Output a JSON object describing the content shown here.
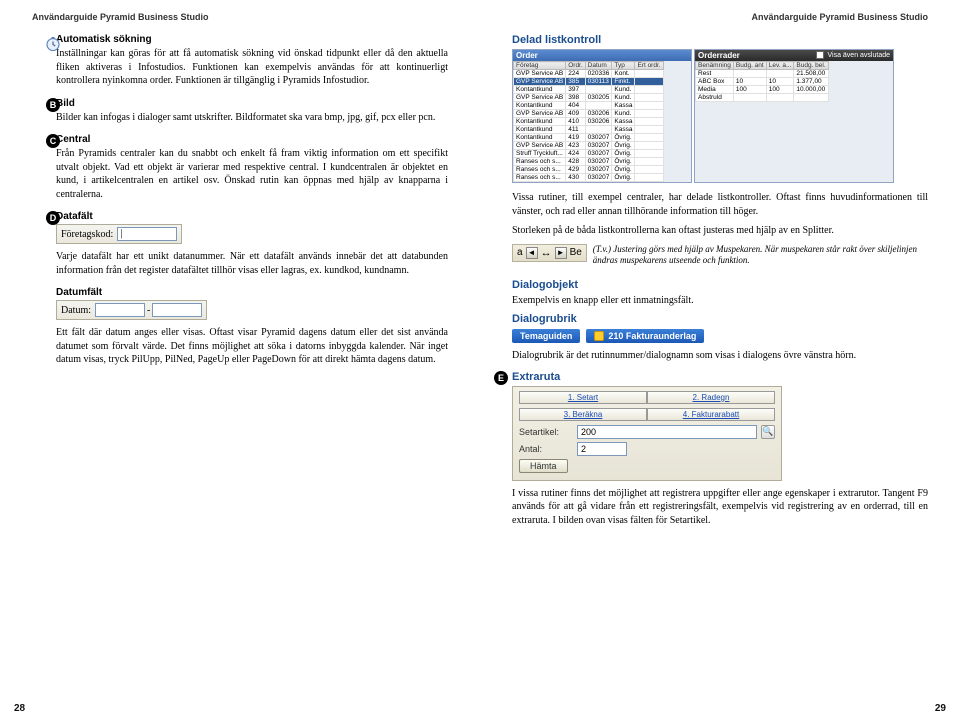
{
  "header": "Användarguide Pyramid Business Studio",
  "left": {
    "auto": {
      "title": "Automatisk sökning",
      "text": "Inställningar kan göras för att få automatisk sökning vid önskad tidpunkt eller då den aktuella fliken aktiveras i Infostudios. Funktionen kan exempelvis användas för att kontinuerligt kontrollera nyinkomna order. Funktionen är tillgänglig i Pyramids Infostudior."
    },
    "bild": {
      "letter": "B",
      "title": "Bild",
      "text": "Bilder kan infogas i dialoger samt utskrifter. Bildformatet ska vara bmp, jpg, gif, pcx eller pcn."
    },
    "central": {
      "letter": "C",
      "title": "Central",
      "text": "Från Pyramids centraler kan du snabbt och enkelt få fram viktig information om ett specifikt utvalt objekt. Vad ett objekt är varierar med respektive central. I kundcentralen är objektet en kund, i artikelcentralen en artikel osv. Önskad rutin kan öppnas med hjälp av knapparna i centralerna."
    },
    "datafalt": {
      "letter": "D",
      "title": "Datafält",
      "input_label": "Företagskod:",
      "text": "Varje datafält har ett unikt datanummer. När ett datafält används innebär det att databunden information från det register datafältet tillhör visas eller lagras, ex. kundkod, kundnamn."
    },
    "datumfalt": {
      "title": "Datumfält",
      "input_label": "Datum:",
      "text": "Ett fält där datum anges eller visas. Oftast visar Pyramid dagens datum eller det sist använda datumet som förvalt värde. Det finns möjlighet att söka i datorns inbyggda kalender. När inget datum visas, tryck PilUpp, PilNed, PageUp eller PageDown för att direkt hämta dagens datum."
    },
    "page_num": "28"
  },
  "right": {
    "delad": {
      "title": "Delad listkontroll",
      "pane_left": {
        "title": "Order",
        "cols": [
          "Företag",
          "Ordr.",
          "Datum",
          "Typ",
          "Ert ordr."
        ],
        "rows": [
          [
            "GVP Service AB",
            "224",
            "020336",
            "Kont.",
            ""
          ],
          [
            "GVP Service AB",
            "385",
            "030113",
            "Finkt.",
            ""
          ],
          [
            "Kontantkund",
            "397",
            "",
            "Kund.",
            ""
          ],
          [
            "GVP Service AB",
            "398",
            "030205",
            "Kund.",
            ""
          ],
          [
            "Kontantkund",
            "404",
            "",
            "Kassa",
            ""
          ],
          [
            "GVP Service AB",
            "409",
            "030206",
            "Kund.",
            ""
          ],
          [
            "Kontantkund",
            "410",
            "030206",
            "Kassa",
            ""
          ],
          [
            "Kontantkund",
            "411",
            "",
            "Kassa",
            ""
          ],
          [
            "Kontantkund",
            "419",
            "030207",
            "Övrig.",
            ""
          ],
          [
            "GVP Service AB",
            "423",
            "030207",
            "Övrig.",
            ""
          ],
          [
            "Struff Tryckluft...",
            "424",
            "030207",
            "Övrig.",
            ""
          ],
          [
            "Ranses och s...",
            "428",
            "030207",
            "Övrig.",
            ""
          ],
          [
            "Ranses och s...",
            "429",
            "030207",
            "Övrig.",
            ""
          ],
          [
            "Ranses och s...",
            "430",
            "030207",
            "Övrig.",
            ""
          ]
        ],
        "sel": 1
      },
      "pane_right": {
        "title": "Orderrader",
        "checkbox": "Visa även avslutade",
        "cols": [
          "Benämning",
          "Budg. ant",
          "Lev. a...",
          "Budg. bel."
        ],
        "rows": [
          [
            "Rest",
            "",
            "",
            "21.508,00"
          ],
          [
            "ABC Box",
            "10",
            "10",
            "1.377,00"
          ],
          [
            "Media",
            "100",
            "100",
            "10.000,00"
          ],
          [
            "Abstruld",
            "",
            "",
            ""
          ]
        ]
      },
      "text": "Vissa rutiner, till exempel centraler, har delade listkontroller. Oftast finns huvudinformationen till vänster, och rad eller annan tillhörande information till höger.",
      "text2": "Storleken på de båda listkontrollerna kan oftast justeras med hjälp av en Splitter.",
      "note": "(T.v.) Justering görs med hjälp av Muspekaren. När muspekaren står rakt över skiljelinjen ändras muspekarens utseende och funktion."
    },
    "splitter": {
      "label_a": "a",
      "label_b": "Be",
      "arrows": "↔"
    },
    "dialogobjekt": {
      "title": "Dialogobjekt",
      "text": "Exempelvis en knapp eller ett inmatningsfält."
    },
    "dialogrubrik": {
      "title": "Dialogrubrik",
      "item1": "Temaguiden",
      "item2": "210 Fakturaunderlag",
      "text": "Dialogrubrik är det rutinnummer/dialognamn som visas i dialogens övre vänstra hörn."
    },
    "extraruta": {
      "letter": "E",
      "title": "Extraruta",
      "tabs": [
        "1. Setart",
        "2. Radegn",
        "3. Beräkna",
        "4. Fakturarabatt"
      ],
      "row1_label": "Setartikel:",
      "row1_value": "200",
      "row2_label": "Antal:",
      "row2_value": "2",
      "button": "Hämta",
      "text": "I vissa rutiner finns det möjlighet att registrera uppgifter eller ange egenskaper i extrarutor. Tangent F9 används för att gå vidare från ett registreringsfält, exempelvis vid registrering av en orderrad, till en extraruta. I bilden ovan visas fälten för Setartikel."
    },
    "page_num": "29"
  }
}
